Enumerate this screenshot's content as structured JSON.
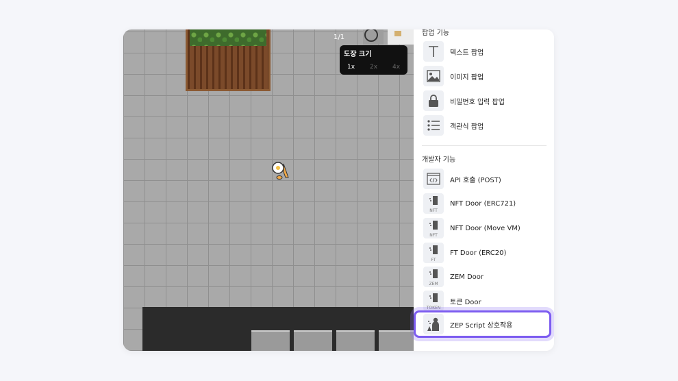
{
  "map": {
    "page_indicator": "1/1",
    "stamp_popup": {
      "title": "도장 크기",
      "options": [
        "1x",
        "2x",
        "4x"
      ],
      "selected": "1x"
    }
  },
  "sidebar": {
    "popup_section_title": "팝업 기능",
    "popup_items": [
      {
        "label": "텍스트 팝업",
        "icon": "text-icon"
      },
      {
        "label": "이미지 팝업",
        "icon": "image-icon"
      },
      {
        "label": "비밀번호 입력 팝업",
        "icon": "lock-icon"
      },
      {
        "label": "객관식 팝업",
        "icon": "list-icon"
      }
    ],
    "dev_section_title": "개발자 기능",
    "dev_items": [
      {
        "label": "API 호출 (POST)",
        "icon": "api-code-icon"
      },
      {
        "label": "NFT Door (ERC721)",
        "icon": "door-icon",
        "sub": "NFT"
      },
      {
        "label": "NFT Door (Move VM)",
        "icon": "door-icon",
        "sub": "NFT"
      },
      {
        "label": "FT Door (ERC20)",
        "icon": "door-icon",
        "sub": "FT"
      },
      {
        "label": "ZEM Door",
        "icon": "door-icon",
        "sub": "ZEM"
      },
      {
        "label": "토큰 Door",
        "icon": "door-icon",
        "sub": "TOKEN"
      },
      {
        "label": "ZEP Script 상호작용",
        "icon": "script-person-icon"
      }
    ],
    "highlight_color": "#7c5cf0"
  }
}
